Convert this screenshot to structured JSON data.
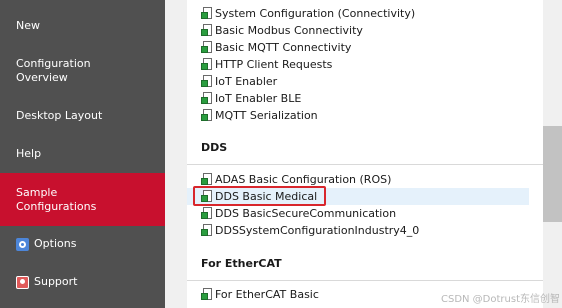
{
  "sidebar": {
    "items": [
      {
        "label": "New"
      },
      {
        "label": "Configuration Overview"
      },
      {
        "label": "Desktop Layout"
      },
      {
        "label": "Help"
      },
      {
        "label": "Sample Configurations",
        "active": true
      },
      {
        "label": "Options",
        "icon": "gear-icon"
      },
      {
        "label": "Support",
        "icon": "support-icon"
      }
    ]
  },
  "content": {
    "top_items": [
      "System Configuration (Connectivity)",
      "Basic Modbus Connectivity",
      "Basic MQTT Connectivity",
      "HTTP Client Requests",
      "IoT Enabler",
      "IoT Enabler BLE",
      "MQTT Serialization"
    ],
    "dds_section": "DDS",
    "dds_items": [
      "ADAS Basic Configuration (ROS)",
      "DDS Basic Medical",
      "DDS BasicSecureCommunication",
      "DDSSystemConfigurationIndustry4_0"
    ],
    "ethercat_section": "For EtherCAT",
    "ethercat_items": [
      "For EtherCAT Basic"
    ]
  },
  "colors": {
    "sidebar_bg": "#505050",
    "active_bg": "#c8102e",
    "highlight_box": "#d8262c",
    "file_icon_green": "#2a9d3f"
  },
  "watermark": "CSDN @Dotrust东信创智"
}
